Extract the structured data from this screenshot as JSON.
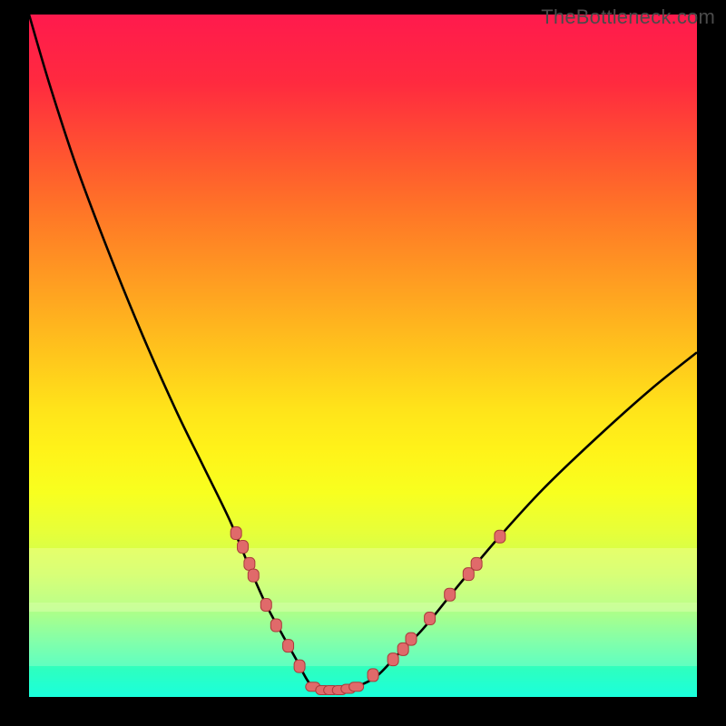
{
  "site_watermark": "TheBottleneck.com",
  "chart_data": {
    "type": "line",
    "title": "",
    "xlabel": "",
    "ylabel": "",
    "xlim": [
      0,
      100
    ],
    "ylim": [
      0,
      100
    ],
    "grid": false,
    "legend": false,
    "series": [
      {
        "name": "bottleneck-curve",
        "x": [
          0,
          3,
          7,
          12,
          17,
          22,
          26,
          30,
          33,
          35.5,
          38,
          40,
          42,
          44,
          46.5,
          49,
          52,
          55,
          59,
          64,
          70,
          77,
          85,
          93,
          100
        ],
        "y": [
          100,
          90,
          78,
          65,
          53,
          42,
          34,
          26,
          19,
          13.5,
          9,
          5.5,
          2,
          1,
          1,
          1.5,
          3,
          6,
          10,
          16,
          23,
          30.5,
          38,
          45,
          50.5
        ]
      }
    ],
    "markers_left": [
      {
        "x": 31.0,
        "y": 24.0
      },
      {
        "x": 32.0,
        "y": 22.0
      },
      {
        "x": 33.0,
        "y": 19.5
      },
      {
        "x": 33.6,
        "y": 17.8
      },
      {
        "x": 35.5,
        "y": 13.5
      },
      {
        "x": 37.0,
        "y": 10.5
      },
      {
        "x": 38.8,
        "y": 7.5
      },
      {
        "x": 40.5,
        "y": 4.5
      }
    ],
    "markers_valley": [
      {
        "x": 42.5,
        "y": 1.5
      },
      {
        "x": 44.0,
        "y": 1.0
      },
      {
        "x": 45.2,
        "y": 1.0
      },
      {
        "x": 46.5,
        "y": 1.0
      },
      {
        "x": 47.8,
        "y": 1.2
      },
      {
        "x": 49.0,
        "y": 1.5
      }
    ],
    "markers_right": [
      {
        "x": 51.5,
        "y": 3.2
      },
      {
        "x": 54.5,
        "y": 5.5
      },
      {
        "x": 56.0,
        "y": 7.0
      },
      {
        "x": 57.2,
        "y": 8.5
      },
      {
        "x": 60.0,
        "y": 11.5
      },
      {
        "x": 63.0,
        "y": 15.0
      },
      {
        "x": 65.8,
        "y": 18.0
      },
      {
        "x": 67.0,
        "y": 19.5
      },
      {
        "x": 70.5,
        "y": 23.5
      }
    ]
  }
}
